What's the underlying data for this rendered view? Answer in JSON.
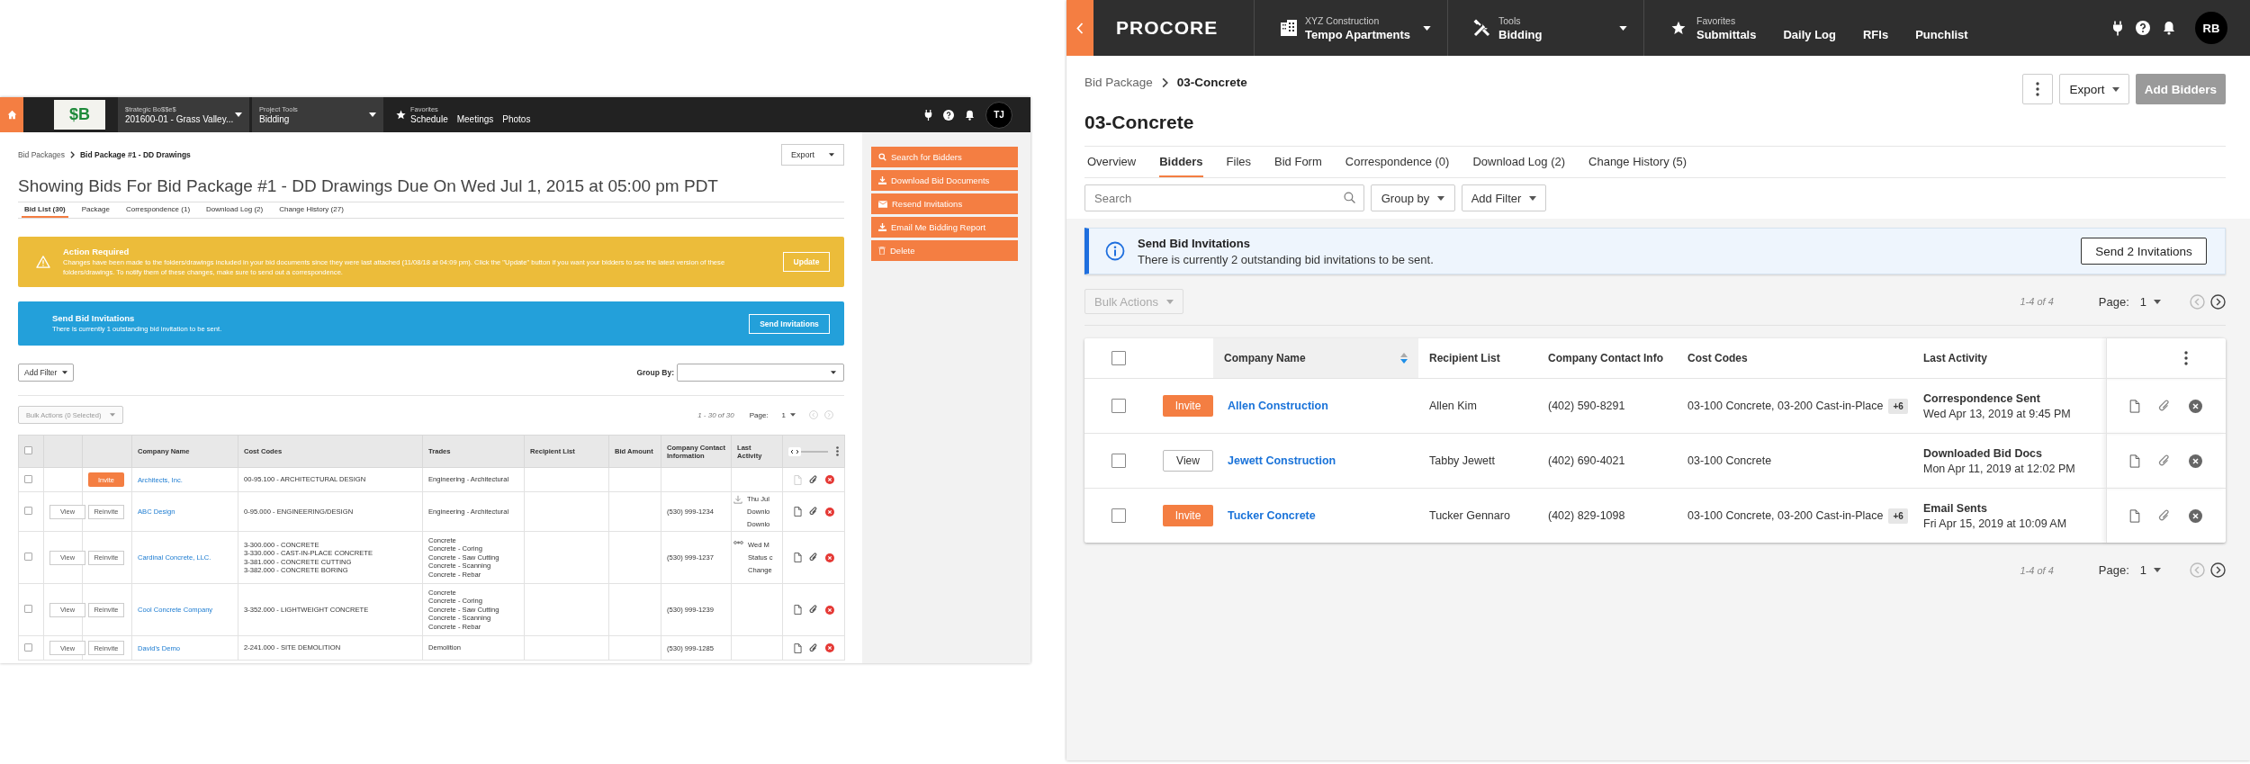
{
  "left_screen": {
    "top_bar": {
      "logo_text": "$B",
      "project": {
        "label": "$trategic Bo$$e$",
        "value": "201600-01 - Grass Valley..."
      },
      "tool": {
        "label": "Project Tools",
        "value": "Bidding"
      },
      "favorites": {
        "label": "Favorites",
        "links": [
          "Schedule",
          "Meetings",
          "Photos"
        ]
      },
      "avatar": "TJ"
    },
    "breadcrumb": [
      "Bid Packages",
      "Bid Package #1 - DD Drawings"
    ],
    "export": "Export",
    "title": "Showing Bids For Bid Package #1 - DD Drawings Due On Wed Jul 1, 2015 at 05:00 pm PDT",
    "tabs": [
      {
        "label": "Bid List (30)",
        "selected": true
      },
      {
        "label": "Package",
        "selected": false
      },
      {
        "label": "Correspondence (1)",
        "selected": false
      },
      {
        "label": "Download Log (2)",
        "selected": false
      },
      {
        "label": "Change History (27)",
        "selected": false
      }
    ],
    "alert": {
      "title": "Action Required",
      "text": "Changes have been made to the folders/drawings included in your bid documents since they were last attached (11/08/18 at 04:09 pm). Click the \"Update\" button if you want your bidders to see the latest version of these folders/drawings. To notify them of these changes, make sure to send out a correspondence.",
      "button": "Update"
    },
    "invite_banner": {
      "title": "Send Bid Invitations",
      "text": "There is currently 1 outstanding bid invitation to be sent.",
      "button": "Send Invitations"
    },
    "add_filter": "Add Filter",
    "group_by": "Group By:",
    "bulk_actions": {
      "label": "Bulk Actions (0 Selected)",
      "disabled": true
    },
    "pagination": {
      "range": "1 - 30 of 30",
      "label": "Page:",
      "page": "1"
    },
    "table": {
      "all_checked": false,
      "columns": [
        "Company Name",
        "Cost Codes",
        "Trades",
        "Recipient List",
        "Bid Amount",
        "Company Contact Information",
        "Last Activity"
      ],
      "rows": [
        {
          "kind": "new",
          "checked": false,
          "buttons": [
            "Invite"
          ],
          "company": "Architects, Inc.",
          "cost_codes": [
            "00-95.100 - ARCHITECTURAL DESIGN"
          ],
          "trades": [
            "Engineering - Architectural"
          ],
          "doc_disabled": true
        },
        {
          "kind": "sent",
          "checked": false,
          "buttons": [
            "View",
            "Reinvite"
          ],
          "company": "ABC Design",
          "cost_codes": [
            "0-95.000 - ENGINEERING/DESIGN"
          ],
          "trades": [
            "Engineering - Architectural"
          ],
          "contact": "(530) 999-1234",
          "activity": {
            "kind": "download",
            "lines": [
              "Thu Jul",
              "Downlo",
              "Downlo"
            ]
          },
          "doc_disabled": false
        },
        {
          "kind": "sent",
          "checked": false,
          "buttons": [
            "View",
            "Reinvite"
          ],
          "company": "Cardinal Concrete, LLC.",
          "cost_codes": [
            "3-300.000 - CONCRETE",
            "3-330.000 - CAST-IN-PLACE CONCRETE",
            "3-381.000 - CONCRETE CUTTING",
            "3-382.000 - CONCRETE BORING"
          ],
          "trades": [
            "Concrete",
            "Concrete - Coring",
            "Concrete - Saw Cutting",
            "Concrete - Scanning",
            "Concrete - Rebar"
          ],
          "contact": "(530) 999-1237",
          "activity": {
            "kind": "status",
            "lines": [
              "Wed M",
              "Status c",
              "Change"
            ]
          },
          "doc_disabled": false
        },
        {
          "kind": "sent",
          "checked": false,
          "buttons": [
            "View",
            "Reinvite"
          ],
          "company": "Cool Concrete Company",
          "cost_codes": [
            "3-352.000 - LIGHTWEIGHT CONCRETE"
          ],
          "trades": [
            "Concrete",
            "Concrete - Coring",
            "Concrete - Saw Cutting",
            "Concrete - Scanning",
            "Concrete - Rebar"
          ],
          "contact": "(530) 999-1239",
          "doc_disabled": false
        },
        {
          "kind": "sent",
          "checked": false,
          "buttons": [
            "View",
            "Reinvite"
          ],
          "company": "David's Demo",
          "cost_codes": [
            "2-241.000 - SITE DEMOLITION"
          ],
          "trades": [
            "Demolition"
          ],
          "contact": "(530) 999-1285",
          "doc_disabled": false
        }
      ]
    },
    "sidebar": [
      {
        "kind": "search",
        "label": "Search for Bidders"
      },
      {
        "kind": "download",
        "label": "Download Bid Documents"
      },
      {
        "kind": "email",
        "label": "Resend Invitations"
      },
      {
        "kind": "download",
        "label": "Email Me Bidding Report"
      },
      {
        "kind": "delete",
        "label": "Delete"
      }
    ]
  },
  "right_screen": {
    "top_bar": {
      "logo": "PROCORE",
      "project": {
        "label": "XYZ Construction",
        "value": "Tempo Apartments"
      },
      "tool": {
        "label": "Tools",
        "value": "Bidding"
      },
      "favorites": {
        "label": "Favorites",
        "links": [
          "Submittals",
          "Daily Log",
          "RFIs",
          "Punchlist"
        ]
      },
      "avatar": "RB"
    },
    "breadcrumb": [
      "Bid Package",
      "03-Concrete"
    ],
    "export": "Export",
    "add_bidders": "Add Bidders",
    "title": "03-Concrete",
    "tabs": [
      {
        "label": "Overview",
        "selected": false
      },
      {
        "label": "Bidders",
        "selected": true
      },
      {
        "label": "Files",
        "selected": false
      },
      {
        "label": "Bid Form",
        "selected": false
      },
      {
        "label": "Correspondence (0)",
        "selected": false
      },
      {
        "label": "Download Log (2)",
        "selected": false
      },
      {
        "label": "Change History (5)",
        "selected": false
      }
    ],
    "search": {
      "placeholder": "Search"
    },
    "group_by": "Group by",
    "add_filter": "Add Filter",
    "banner": {
      "title": "Send Bid Invitations",
      "text": "There is currently 2 outstanding bid invitations to be sent.",
      "button": "Send 2 Invitations"
    },
    "bulk_actions": {
      "label": "Bulk Actions",
      "disabled": true
    },
    "pagination_top": {
      "range": "1-4 of 4",
      "label": "Page:",
      "page": "1"
    },
    "table": {
      "all_checked": false,
      "columns": [
        {
          "label": "Company Name",
          "sorted": true
        },
        {
          "label": "Recipient List",
          "sorted": false
        },
        {
          "label": "Company Contact Info",
          "sorted": false
        },
        {
          "label": "Cost Codes",
          "sorted": false
        },
        {
          "label": "Last Activity",
          "sorted": false
        }
      ],
      "rows": [
        {
          "kind": "invite",
          "checked": false,
          "button": "Invite",
          "company": "Allen Construction",
          "recipient": "Allen Kim",
          "contact": "(402) 590-8291",
          "cost_codes": "03-100 Concrete, 03-200 Cast-in-Place",
          "extra": "+6",
          "activity_title": "Correspondence Sent",
          "activity_time": "Wed Apr 13, 2019 at 9:45 PM"
        },
        {
          "kind": "view",
          "checked": false,
          "button": "View",
          "company": "Jewett Construction",
          "recipient": "Tabby Jewett",
          "contact": "(402) 690-4021",
          "cost_codes": "03-100 Concrete",
          "activity_title": "Downloaded Bid Docs",
          "activity_time": "Mon Apr 11, 2019 at 12:02 PM"
        },
        {
          "kind": "invite",
          "checked": false,
          "button": "Invite",
          "company": "Tucker Concrete",
          "recipient": "Tucker Gennaro",
          "contact": "(402) 829-1098",
          "cost_codes": "03-100 Concrete, 03-200 Cast-in-Place",
          "extra": "+6",
          "activity_title": "Email Sents",
          "activity_time": "Fri Apr 15, 2019 at 10:09 AM"
        }
      ]
    },
    "pagination_bottom": {
      "range": "1-4 of 4",
      "label": "Page:",
      "page": "1"
    }
  }
}
